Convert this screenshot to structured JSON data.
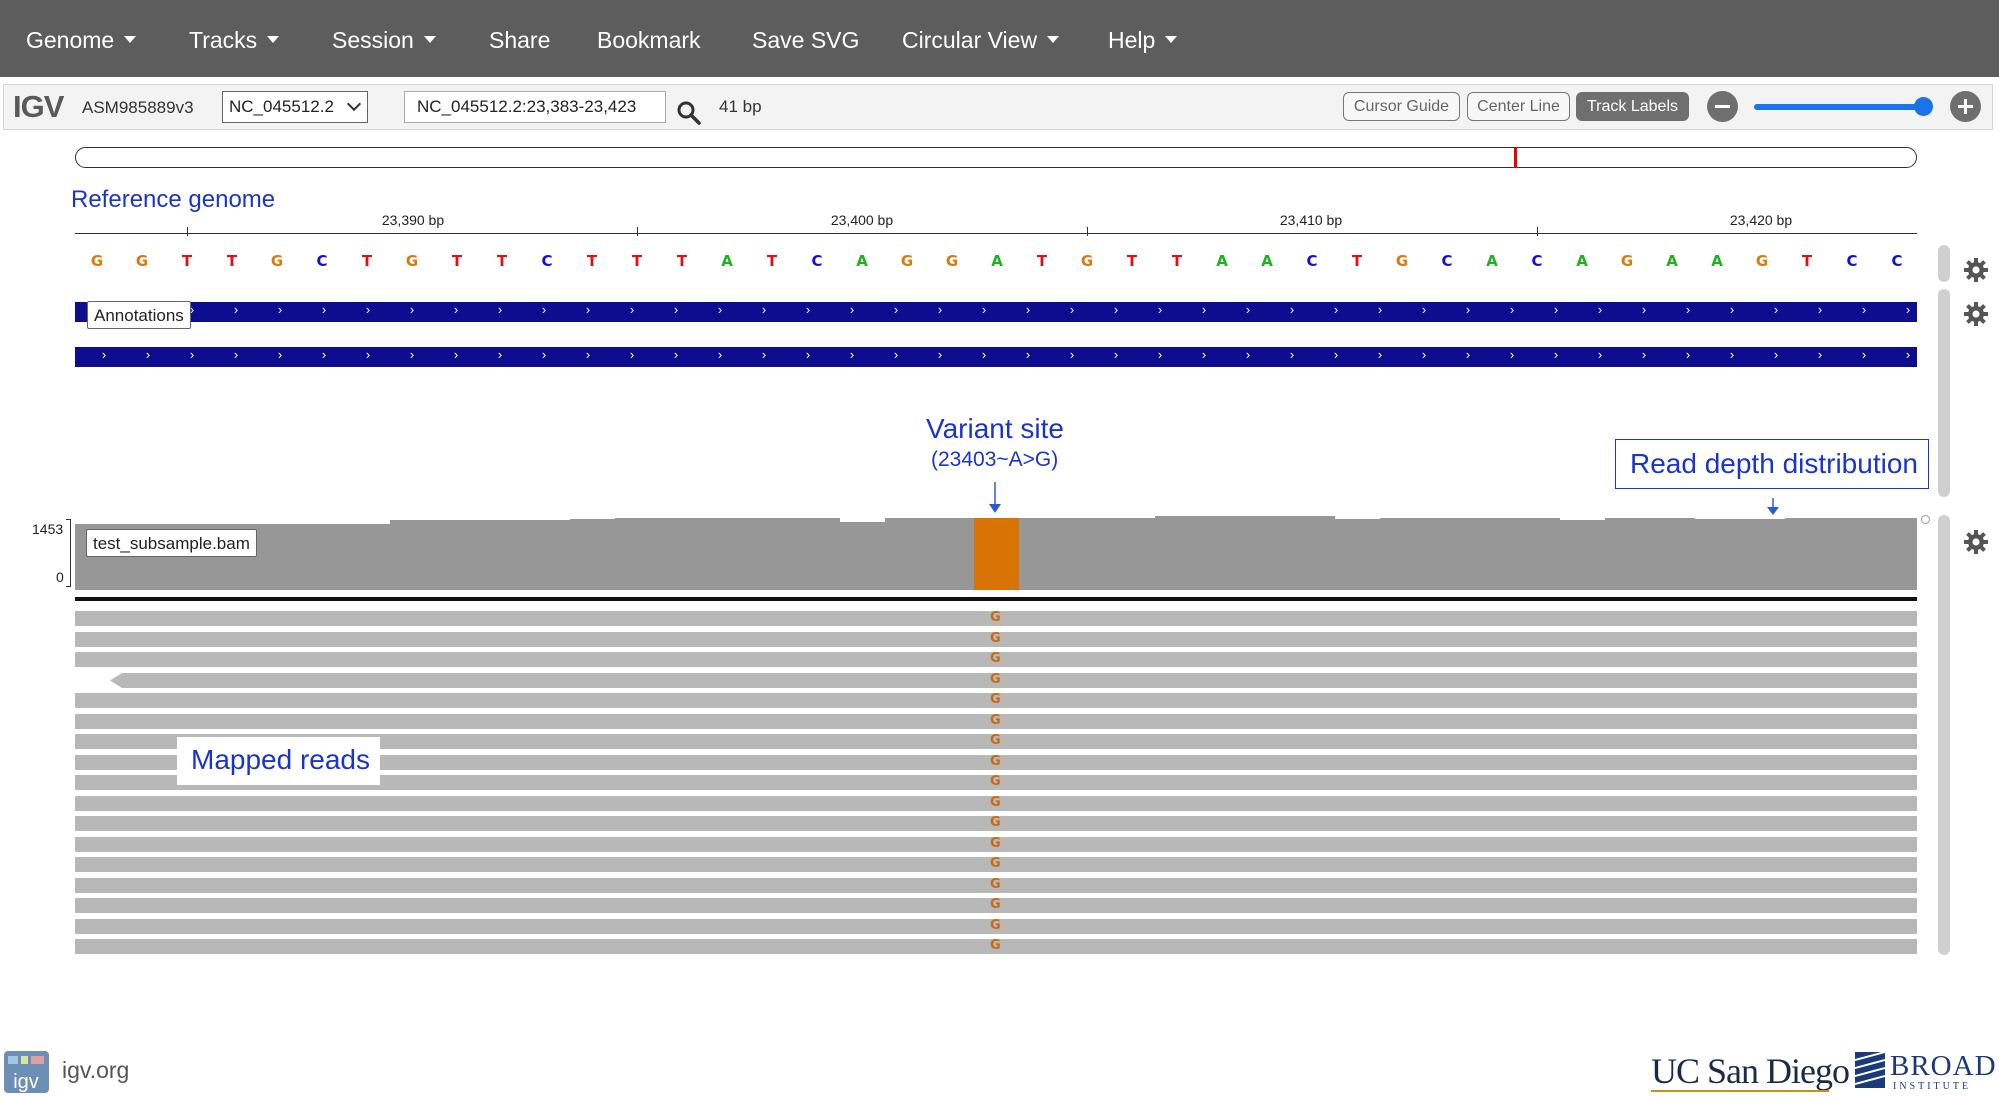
{
  "navbar": {
    "items": [
      {
        "label": "Genome",
        "dropdown": true
      },
      {
        "label": "Tracks",
        "dropdown": true
      },
      {
        "label": "Session",
        "dropdown": true
      },
      {
        "label": "Share",
        "dropdown": false
      },
      {
        "label": "Bookmark",
        "dropdown": false
      },
      {
        "label": "Save SVG",
        "dropdown": false
      },
      {
        "label": "Circular View",
        "dropdown": true
      },
      {
        "label": "Help",
        "dropdown": true
      }
    ]
  },
  "toolbar": {
    "logo": "IGV",
    "genome": "ASM985889v3",
    "chromosome": "NC_045512.2",
    "locus": "NC_045512.2:23,383-23,423",
    "width_label": "41 bp",
    "buttons": {
      "cursor_guide": "Cursor Guide",
      "center_line": "Center Line",
      "track_labels": "Track Labels"
    },
    "zoom_level": 1.0,
    "search_icon": "search-icon"
  },
  "ruler": {
    "ticks": [
      "23,390 bp",
      "23,400 bp",
      "23,410 bp",
      "23,420 bp"
    ]
  },
  "reference": {
    "label": "Reference genome",
    "sequence": [
      "G",
      "G",
      "T",
      "T",
      "G",
      "C",
      "T",
      "G",
      "T",
      "T",
      "C",
      "T",
      "T",
      "T",
      "A",
      "T",
      "C",
      "A",
      "G",
      "G",
      "A",
      "T",
      "G",
      "T",
      "T",
      "A",
      "A",
      "C",
      "T",
      "G",
      "C",
      "A",
      "C",
      "A",
      "G",
      "A",
      "A",
      "G",
      "T",
      "C",
      "C"
    ],
    "colors": {
      "A": "#1ab41a",
      "C": "#1010d8",
      "G": "#d97a10",
      "T": "#e01010"
    }
  },
  "annotations": {
    "label": "Annotations"
  },
  "annotation_callouts": {
    "variant_title": "Variant site",
    "variant_detail": "(23403~A>G)",
    "depth": "Read depth distribution",
    "mapped": "Mapped reads"
  },
  "alignment": {
    "track_name": "test_subsample.bam",
    "scale_max": "1453",
    "scale_min": "0",
    "variant_base": "G",
    "variant_color": "#d97306",
    "coverage_color": "#979797",
    "read_color": "#b8b8b8"
  },
  "footer": {
    "link": "igv.org",
    "icon_text": "igv",
    "ucsd": "UC San Diego",
    "broad": "BROAD",
    "broad_sub": "INSTITUTE"
  }
}
